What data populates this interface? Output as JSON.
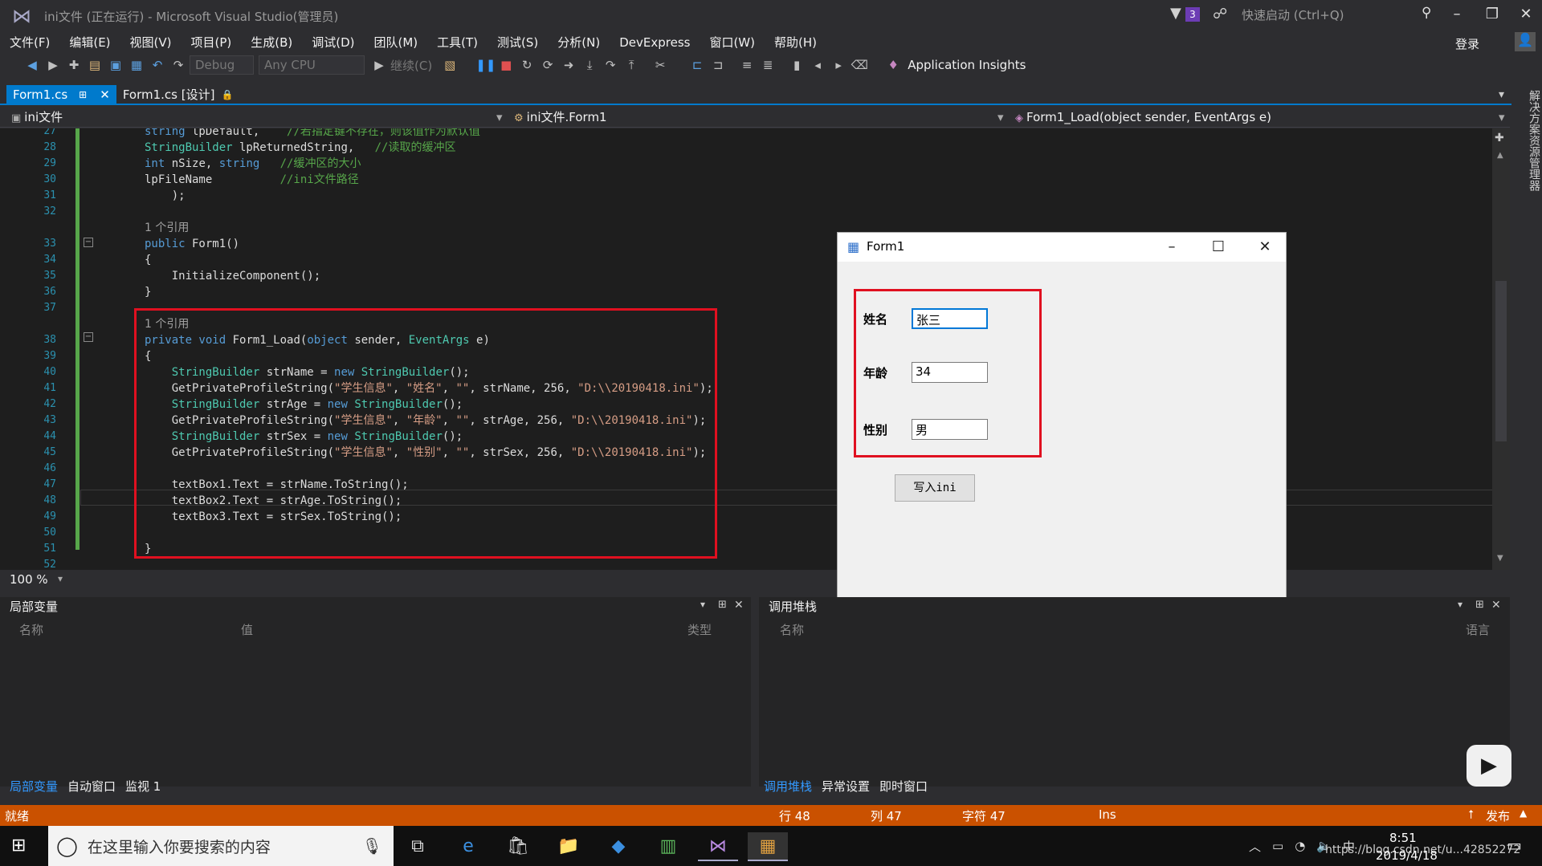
{
  "titlebar": {
    "title": "ini文件 (正在运行) - Microsoft Visual Studio(管理员)",
    "notif_count": "3",
    "quicklaunch_placeholder": "快速启动 (Ctrl+Q)"
  },
  "menu": [
    "文件(F)",
    "编辑(E)",
    "视图(V)",
    "项目(P)",
    "生成(B)",
    "调试(D)",
    "团队(M)",
    "工具(T)",
    "测试(S)",
    "分析(N)",
    "DevExpress",
    "窗口(W)",
    "帮助(H)"
  ],
  "login": "登录",
  "toolbar": {
    "config": "Debug",
    "platform": "Any CPU",
    "continue": "继续(C)",
    "app_insights": "Application Insights"
  },
  "tabs": {
    "active": "Form1.cs",
    "design": "Form1.cs [设计]"
  },
  "navbar": {
    "project": "ini文件",
    "class": "ini文件.Form1",
    "member": "Form1_Load(object sender, EventArgs e)"
  },
  "line_numbers": [
    "27",
    "28",
    "29",
    "30",
    "31",
    "32",
    "33",
    "34",
    "35",
    "36",
    "37",
    "38",
    "39",
    "40",
    "41",
    "42",
    "43",
    "44",
    "45",
    "46",
    "47",
    "48",
    "49",
    "50",
    "51",
    "52"
  ],
  "code": {
    "l27": "string lpDefault,    //若指定键不存在，则该值作为默认值",
    "l28": "StringBuilder lpReturnedString,   //读取的缓冲区",
    "l29": "int nSize, string   //缓冲区的大小",
    "l30": "lpFileName          //ini文件路径",
    "l31": "    );",
    "ref1": "1 个引用",
    "l33": "public Form1()",
    "l34": "{",
    "l35": "    InitializeComponent();",
    "l36": "}",
    "ref2": "1 个引用",
    "l38": "private void Form1_Load(object sender, EventArgs e)",
    "l39": "{",
    "l40": "    StringBuilder strName = new StringBuilder();",
    "l41": "    GetPrivateProfileString(\"学生信息\", \"姓名\", \"\", strName, 256, \"D:\\\\20190418.ini\");",
    "l42": "    StringBuilder strAge = new StringBuilder();",
    "l43": "    GetPrivateProfileString(\"学生信息\", \"年龄\", \"\", strAge, 256, \"D:\\\\20190418.ini\");",
    "l44": "    StringBuilder strSex = new StringBuilder();",
    "l45": "    GetPrivateProfileString(\"学生信息\", \"性别\", \"\", strSex, 256, \"D:\\\\20190418.ini\");",
    "l47": "    textBox1.Text = strName.ToString();",
    "l48": "    textBox2.Text = strAge.ToString();",
    "l49": "    textBox3.Text = strSex.ToString();",
    "l51": "}"
  },
  "zoom": "100 %",
  "form": {
    "title": "Form1",
    "name_label": "姓名",
    "name_value": "张三",
    "age_label": "年龄",
    "age_value": "34",
    "sex_label": "性别",
    "sex_value": "男",
    "button": "写入ini"
  },
  "locals": {
    "title": "局部变量",
    "col_name": "名称",
    "col_value": "值",
    "col_type": "类型",
    "tabs": [
      "局部变量",
      "自动窗口",
      "监视 1"
    ]
  },
  "callstack": {
    "title": "调用堆栈",
    "col_name": "名称",
    "col_lang": "语言",
    "tabs": [
      "调用堆栈",
      "异常设置",
      "即时窗口"
    ]
  },
  "status": {
    "ready": "就绪",
    "row": "行 48",
    "col": "列 47",
    "char": "字符 47",
    "mode": "Ins",
    "publish": "发布"
  },
  "taskbar": {
    "search_placeholder": "在这里输入你要搜索的内容",
    "time": "8:51",
    "date": "2019/4/18",
    "watermark": "https://blog.csdn.net/u...42852272"
  },
  "side_panel": "解决方案资源管理器",
  "colors": {
    "accent": "#007acc",
    "status": "#ca5100",
    "highlight": "#e01020"
  }
}
